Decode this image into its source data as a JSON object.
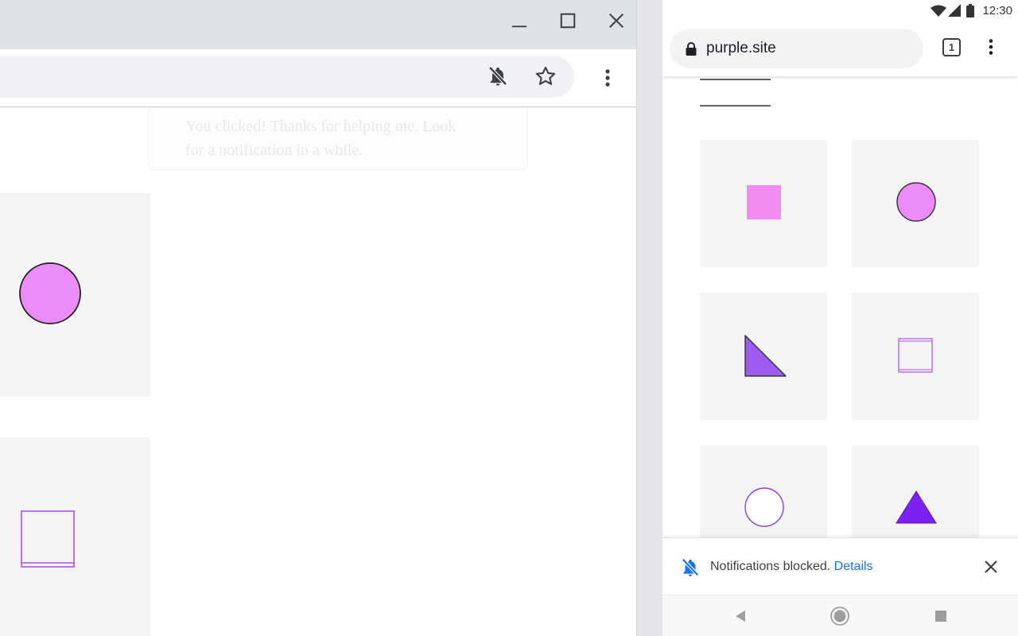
{
  "desktop": {
    "faded_text_line1": "You clicked! Thanks for helping me. Look",
    "faded_text_line2": "for a notification in a while."
  },
  "phone": {
    "status": {
      "time": "12:30"
    },
    "url": "purple.site",
    "tab_count": "1",
    "snackbar": {
      "message": "Notifications blocked.",
      "link": "Details"
    }
  },
  "colors": {
    "shape_pink": "#ec8cfa",
    "shape_light_pink": "#f08cf2",
    "shape_purple": "#a05cf0",
    "shape_violet": "#7b22f2",
    "link_blue": "#1a73e8",
    "tile_bg": "#f4f4f5"
  }
}
